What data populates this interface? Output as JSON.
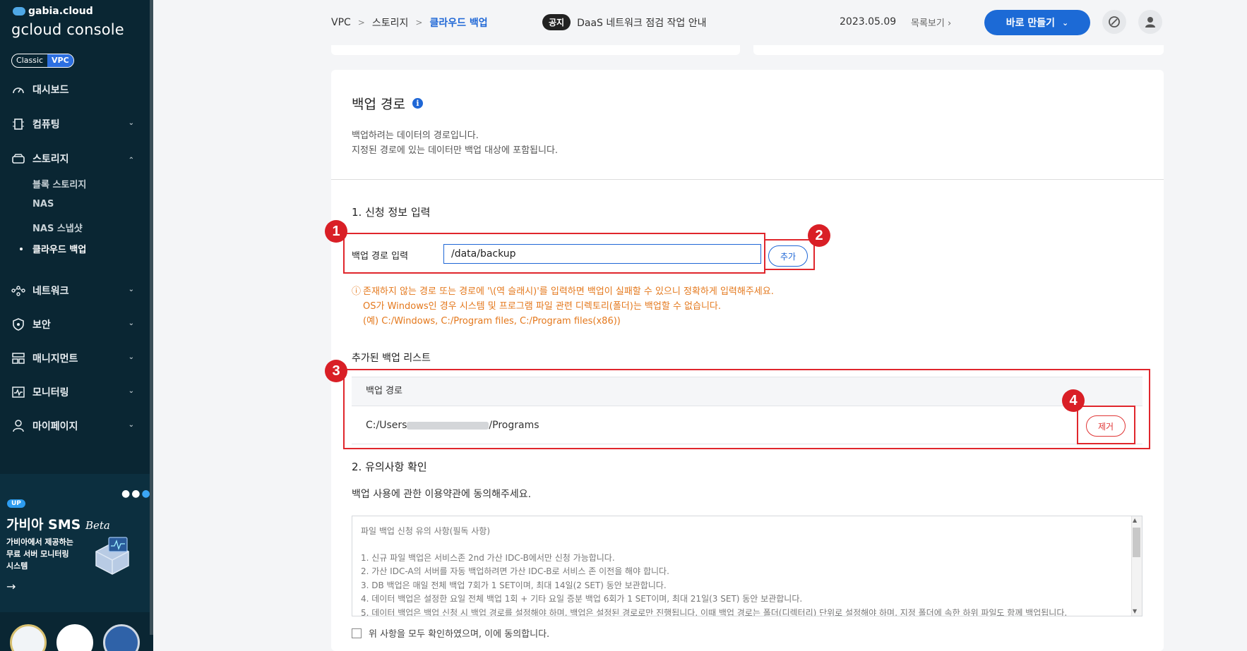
{
  "sidebar": {
    "brand_top": "gabia.cloud",
    "brand_main": "gcloud console",
    "toggle": [
      "Classic",
      "VPC"
    ],
    "items": [
      {
        "label": "대시보드",
        "icon": "gauge-icon"
      },
      {
        "label": "컴퓨팅",
        "icon": "chip-icon"
      },
      {
        "label": "스토리지",
        "icon": "storage-icon"
      },
      {
        "label": "네트워크",
        "icon": "network-icon"
      },
      {
        "label": "보안",
        "icon": "shield-icon"
      },
      {
        "label": "매니지먼트",
        "icon": "management-icon"
      },
      {
        "label": "모니터링",
        "icon": "monitor-icon"
      },
      {
        "label": "마이페이지",
        "icon": "user-icon"
      }
    ],
    "sub_items": [
      "블록 스토리지",
      "NAS",
      "NAS 스냅샷",
      "클라우드 백업"
    ],
    "promo": {
      "badge": "UP",
      "title": "가비아 SMS",
      "beta": "Beta",
      "desc_lines": [
        "가비아에서 제공하는",
        "무료 서버 모니터링",
        "시스템"
      ],
      "arrow": "→"
    }
  },
  "topbar": {
    "breadcrumb": [
      "VPC",
      "스토리지",
      "클라우드 백업"
    ],
    "notice_badge": "공지",
    "notice_text": "DaaS 네트워크 점검 작업 안내",
    "date": "2023.05.09",
    "list_link": "목록보기",
    "make_button": "바로 만들기"
  },
  "section": {
    "title": "백업 경로",
    "desc_lines": [
      "백업하려는 데이터의 경로입니다.",
      "지정된 경로에 있는 데이터만 백업 대상에 포함됩니다."
    ]
  },
  "step1": {
    "title": "1. 신청 정보 입력",
    "field_label": "백업 경로 입력",
    "field_value": "/data/backup",
    "add_button": "추가",
    "warning_symbol": "ⓘ",
    "warnings": [
      "존재하지 않는 경로 또는 경로에 '\\(역 슬래시)'를 입력하면 백업이 실패할 수 있으니 정확하게 입력해주세요.",
      "OS가 Windows인 경우 시스템 및 프로그램 파일 관련 디렉토리(폴더)는 백업할 수 없습니다.",
      "(예) C:/Windows, C:/Program files, C:/Program files(x86))"
    ]
  },
  "added_list": {
    "title": "추가된 백업 리스트",
    "column": "백업 경로",
    "row_prefix": "C:/Users",
    "row_suffix": "/Programs",
    "remove_button": "제거"
  },
  "step2": {
    "title": "2. 유의사항 확인",
    "desc": "백업 사용에 관한 이용약관에 동의해주세요.",
    "terms_head": "파일 백업 신청 유의 사항(필독 사항)",
    "terms": [
      "1. 신규 파일 백업은 서비스존 2nd 가산 IDC-B에서만 신청 가능합니다.",
      "2. 가산 IDC-A의 서버를 자동 백업하려면 가산 IDC-B로 서비스 존 이전을 해야 합니다.",
      "3. DB 백업은 매일 전체 백업 7회가 1 SET이며, 최대 14일(2 SET) 동안 보관합니다.",
      "4. 데이터 백업은 설정한 요일 전체 백업 1회 + 기타 요일 증분 백업 6회가 1 SET이며, 최대 21일(3 SET) 동안 보관합니다.",
      "5. 데이터 백업은 백업 신청 시 백업 경로를 설정해야 하며, 백업은 설정된 경로로만 진행됩니다. 이때 백업 경로는 폴더(디렉터리) 단위로 설정해야 하며, 지정 폴더에 속한 하위 파일도 함께 백업됩니다."
    ],
    "agree_label": "위 사항을 모두 확인하였으며, 이에 동의합니다."
  },
  "annotations": [
    "1",
    "2",
    "3",
    "4"
  ],
  "colors": {
    "accent": "#1f67d6",
    "sidebar": "#0a2633",
    "warning": "#e4781c",
    "annotation": "#e0262c"
  }
}
